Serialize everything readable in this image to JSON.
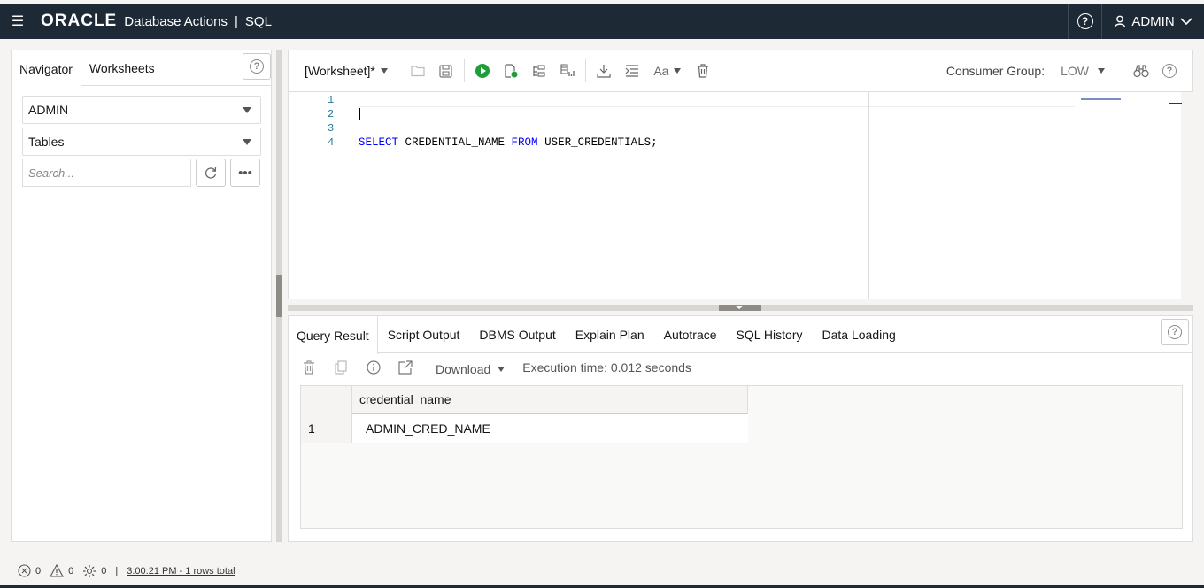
{
  "header": {
    "brand": "ORACLE",
    "product": "Database Actions",
    "separator": "|",
    "section": "SQL",
    "user": "ADMIN"
  },
  "left_panel": {
    "tabs": [
      {
        "label": "Navigator"
      },
      {
        "label": "Worksheets"
      }
    ],
    "schema_select": "ADMIN",
    "object_select": "Tables",
    "search_placeholder": "Search..."
  },
  "toolbar": {
    "worksheet_label": "[Worksheet]*",
    "consumer_group_label": "Consumer Group:",
    "consumer_group_value": "LOW",
    "font_label": "Aa"
  },
  "editor": {
    "line_numbers": [
      "1",
      "2",
      "3",
      "4"
    ],
    "code": {
      "kw1": "SELECT",
      "col": " CREDENTIAL_NAME ",
      "kw2": "FROM",
      "tbl": " USER_CREDENTIALS;"
    }
  },
  "results": {
    "tabs": [
      "Query Result",
      "Script Output",
      "DBMS Output",
      "Explain Plan",
      "Autotrace",
      "SQL History",
      "Data Loading"
    ],
    "download_label": "Download",
    "execution_time": "Execution time: 0.012 seconds",
    "columns": [
      "credential_name"
    ],
    "rows": [
      {
        "num": "1",
        "credential_name": "ADMIN_CRED_NAME"
      }
    ]
  },
  "status": {
    "errors": "0",
    "warnings": "0",
    "tasks": "0",
    "separator": "|",
    "info": "3:00:21 PM - 1 rows total"
  }
}
